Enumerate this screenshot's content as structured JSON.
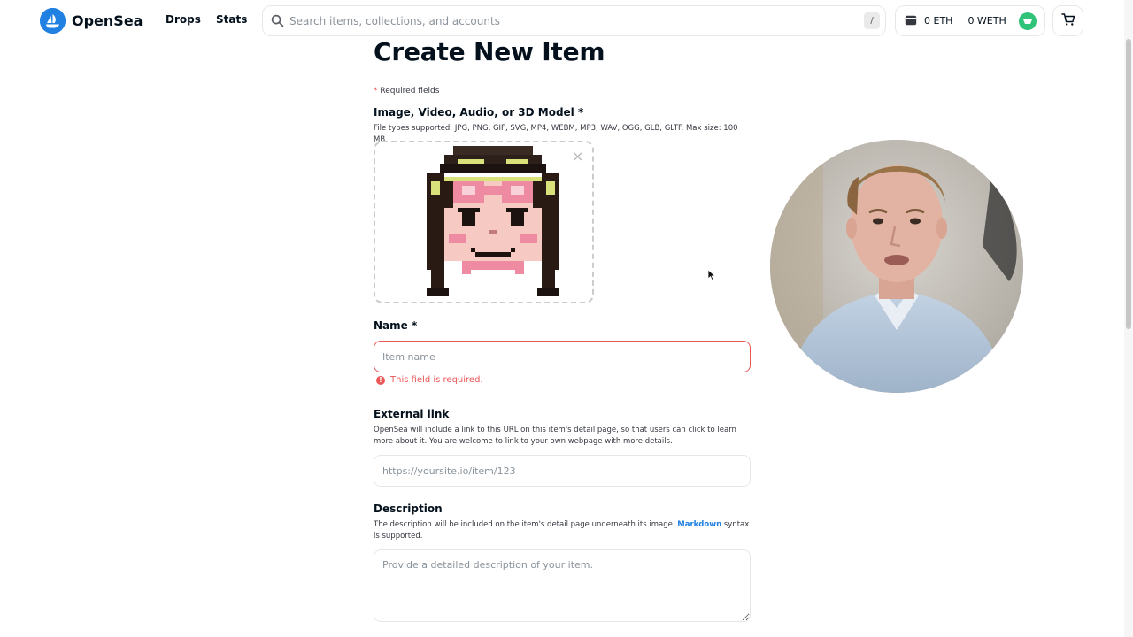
{
  "header": {
    "logo_text": "OpenSea",
    "nav": [
      {
        "label": "Drops"
      },
      {
        "label": "Stats"
      }
    ],
    "search": {
      "placeholder": "Search items, collections, and accounts",
      "shortcut": "/"
    },
    "wallet": {
      "eth": "0 ETH",
      "weth": "0 WETH"
    },
    "icons": [
      "opensea-logo-icon",
      "search-icon",
      "wallet-icon",
      "account-avatar-icon",
      "cart-icon"
    ]
  },
  "form": {
    "title": "Create New Item",
    "required_note_asterisk": "*",
    "required_note": "Required fields",
    "media": {
      "label": "Image, Video, Audio, or 3D Model *",
      "help": "File types supported: JPG, PNG, GIF, SVG, MP4, WEBM, MP3, WAV, OGG, GLB, GLTF. Max size: 100 MB",
      "remove_icon": "×"
    },
    "name": {
      "label": "Name *",
      "placeholder": "Item name",
      "value": "",
      "error": "This field is required."
    },
    "external_link": {
      "label": "External link",
      "help": "OpenSea will include a link to this URL on this item's detail page, so that users can click to learn more about it. You are welcome to link to your own webpage with more details.",
      "placeholder": "https://yoursite.io/item/123"
    },
    "description": {
      "label": "Description",
      "help_before": "The description will be included on the item's detail page underneath its image.",
      "help_link": "Markdown",
      "help_after": "syntax is supported.",
      "placeholder": "Provide a detailed description of your item."
    }
  },
  "colors": {
    "brand": "#2081e2",
    "error": "#eb5757",
    "border": "#e5e8eb",
    "text": "#04111d",
    "avatar": "#2fc37a"
  }
}
